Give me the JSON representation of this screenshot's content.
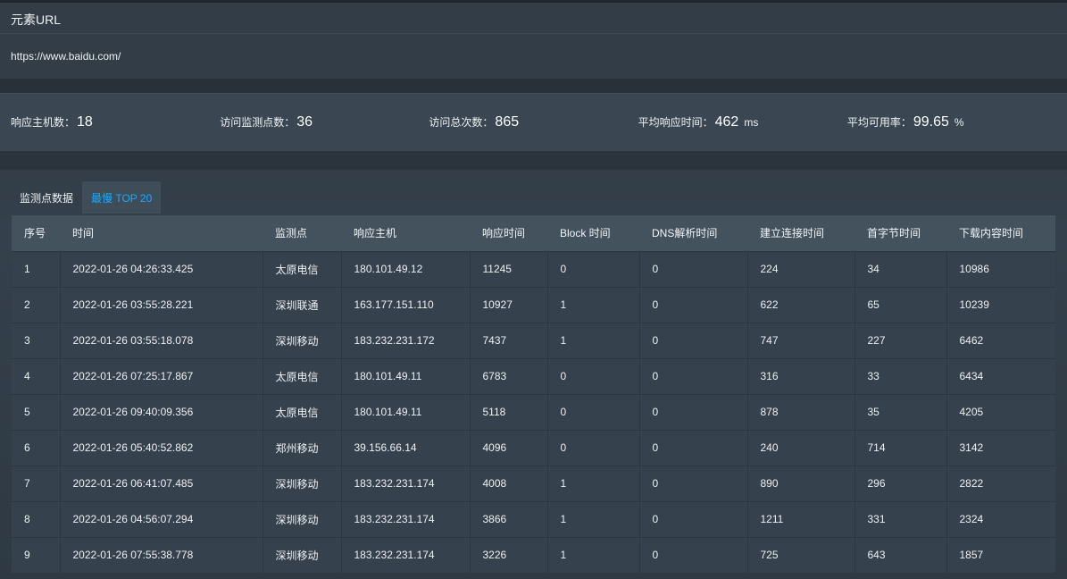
{
  "url_section": {
    "label": "元素URL",
    "value": "https://www.baidu.com/"
  },
  "stats": [
    {
      "label": "响应主机数：",
      "value": "18",
      "unit": ""
    },
    {
      "label": "访问监测点数：",
      "value": "36",
      "unit": ""
    },
    {
      "label": "访问总次数：",
      "value": "865",
      "unit": ""
    },
    {
      "label": "平均响应时间：",
      "value": "462",
      "unit": "ms"
    },
    {
      "label": "平均可用率：",
      "value": "99.65",
      "unit": "%"
    }
  ],
  "tabs": [
    {
      "label": "监测点数据",
      "active": false
    },
    {
      "label": "最慢 TOP 20",
      "active": true
    }
  ],
  "table": {
    "columns": [
      "序号",
      "时间",
      "监测点",
      "响应主机",
      "响应时间",
      "Block 时间",
      "DNS解析时间",
      "建立连接时间",
      "首字节时间",
      "下载内容时间"
    ],
    "rows": [
      [
        "1",
        "2022-01-26 04:26:33.425",
        "太原电信",
        "180.101.49.12",
        "11245",
        "0",
        "0",
        "224",
        "34",
        "10986"
      ],
      [
        "2",
        "2022-01-26 03:55:28.221",
        "深圳联通",
        "163.177.151.110",
        "10927",
        "1",
        "0",
        "622",
        "65",
        "10239"
      ],
      [
        "3",
        "2022-01-26 03:55:18.078",
        "深圳移动",
        "183.232.231.172",
        "7437",
        "1",
        "0",
        "747",
        "227",
        "6462"
      ],
      [
        "4",
        "2022-01-26 07:25:17.867",
        "太原电信",
        "180.101.49.11",
        "6783",
        "0",
        "0",
        "316",
        "33",
        "6434"
      ],
      [
        "5",
        "2022-01-26 09:40:09.356",
        "太原电信",
        "180.101.49.11",
        "5118",
        "0",
        "0",
        "878",
        "35",
        "4205"
      ],
      [
        "6",
        "2022-01-26 05:40:52.862",
        "郑州移动",
        "39.156.66.14",
        "4096",
        "0",
        "0",
        "240",
        "714",
        "3142"
      ],
      [
        "7",
        "2022-01-26 06:41:07.485",
        "深圳移动",
        "183.232.231.174",
        "4008",
        "1",
        "0",
        "890",
        "296",
        "2822"
      ],
      [
        "8",
        "2022-01-26 04:56:07.294",
        "深圳移动",
        "183.232.231.174",
        "3866",
        "1",
        "0",
        "1211",
        "331",
        "2324"
      ],
      [
        "9",
        "2022-01-26 07:55:38.778",
        "深圳移动",
        "183.232.231.174",
        "3226",
        "1",
        "0",
        "725",
        "643",
        "1857"
      ]
    ]
  },
  "colors": {
    "accent": "#1ea7ff"
  }
}
